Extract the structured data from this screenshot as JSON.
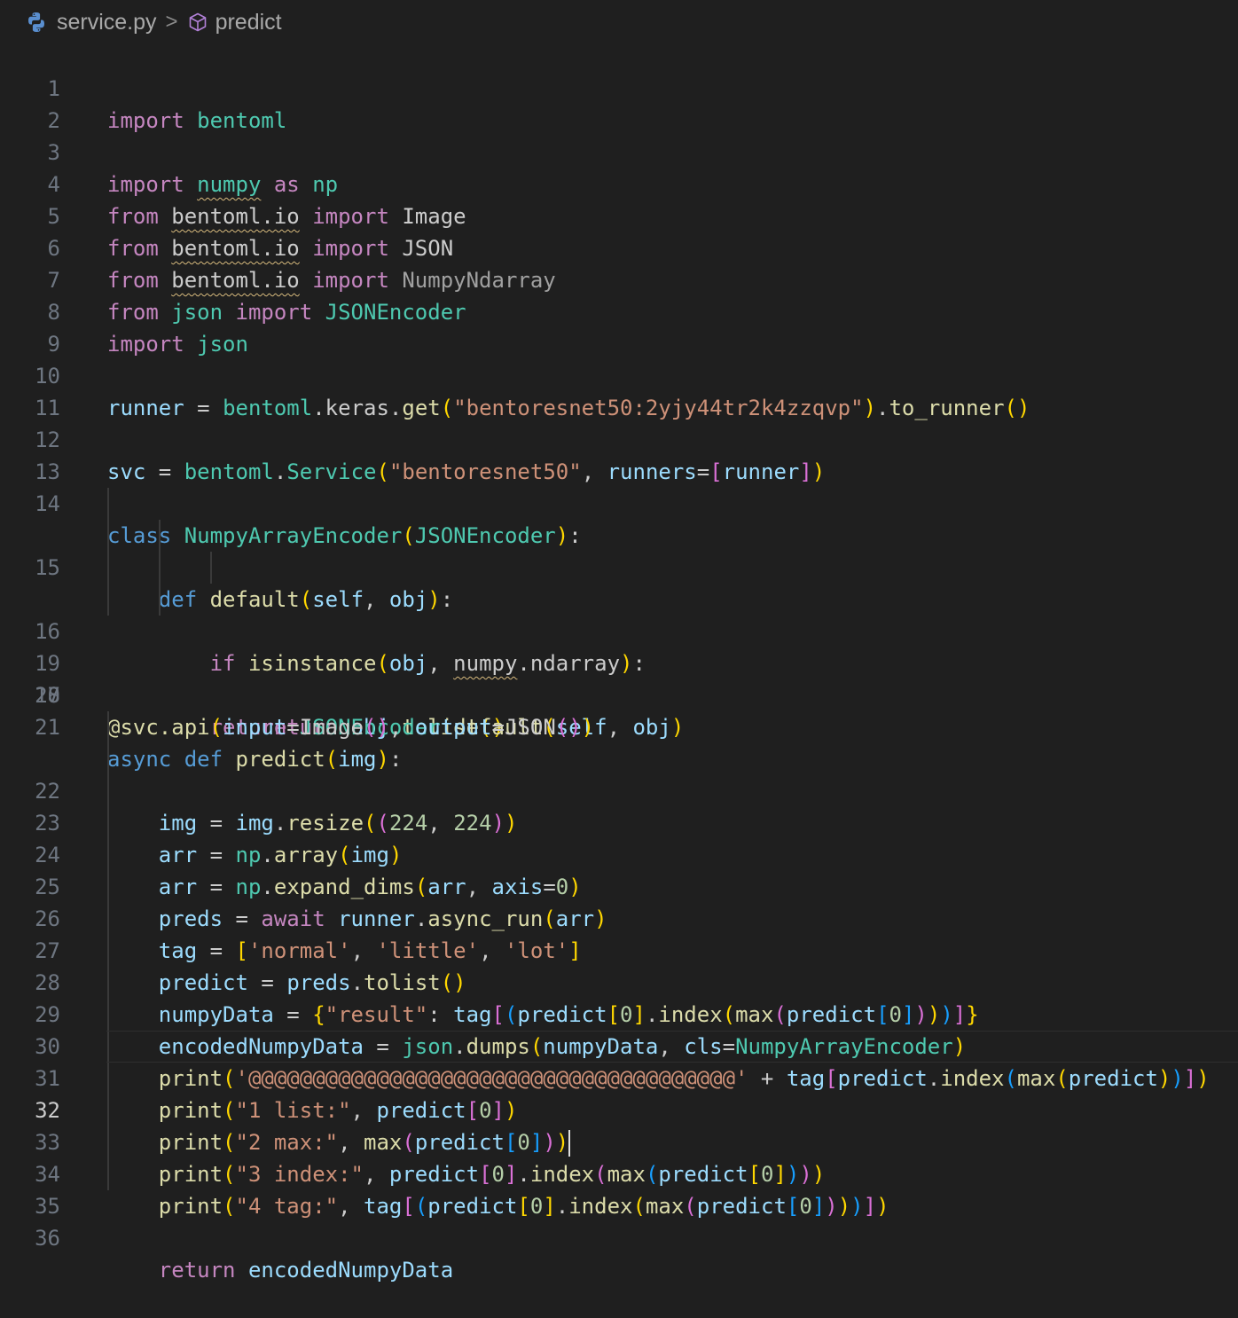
{
  "breadcrumb": {
    "file_name": "service.py",
    "separator": ">",
    "symbol_name": "predict"
  },
  "editor": {
    "language": "python",
    "active_line": 32,
    "line_numbers": [
      "1",
      "2",
      "3",
      "4",
      "5",
      "6",
      "7",
      "8",
      "9",
      "10",
      "11",
      "12",
      "13",
      "14",
      "15",
      "16",
      "17",
      "18",
      "19",
      "20",
      "21",
      "22",
      "23",
      "24",
      "25",
      "26",
      "27",
      "28",
      "29",
      "30",
      "31",
      "32",
      "33",
      "34",
      "35",
      "36"
    ],
    "lines": [
      "import bentoml",
      "",
      "import numpy as np",
      "from bentoml.io import Image",
      "from bentoml.io import JSON",
      "from bentoml.io import NumpyNdarray",
      "from json import JSONEncoder",
      "import json",
      "",
      "runner = bentoml.keras.get(\"bentoresnet50:2yjy44tr2k4zzqvp\").to_runner()",
      "",
      "svc = bentoml.Service(\"bentoresnet50\", runners=[runner])",
      "",
      "class NumpyArrayEncoder(JSONEncoder):",
      "    def default(self, obj):",
      "        if isinstance(obj, numpy.ndarray):",
      "            return obj.tolist()",
      "        return JSONEncoder.default(self, obj)",
      "",
      "@svc.api(input=Image(), output=JSON())",
      "async def predict(img):",
      "    img = img.resize((224, 224))",
      "    arr = np.array(img)",
      "    arr = np.expand_dims(arr, axis=0)",
      "    preds = await runner.async_run(arr)",
      "    tag = ['normal', 'little', 'lot']",
      "    predict = preds.tolist()",
      "    numpyData = {\"result\": tag[(predict[0].index(max(predict[0])))]}",
      "    encodedNumpyData = json.dumps(numpyData, cls=NumpyArrayEncoder)",
      "    print('@@@@@@@@@@@@@@@@@@@@@@@@@@@@@@@@@@@@@@' + tag[predict.index(max(predict))])",
      "    print(\"1 list:\", predict[0])",
      "    print(\"2 max:\", max(predict[0]))",
      "    print(\"3 index:\", predict[0].index(max(predict[0])))",
      "    print(\"4 tag:\", tag[(predict[0].index(max(predict[0])))])",
      "",
      "    return encodedNumpyData"
    ]
  },
  "colors": {
    "background": "#1f1f1f",
    "keyword": "#c586c0",
    "storage_keyword": "#569cd6",
    "module_class": "#4ec9b0",
    "function": "#dcdcaa",
    "variable": "#9cdcfe",
    "string": "#ce9178",
    "number": "#b5cea8",
    "bracket_level_1": "#ffd700",
    "bracket_level_2": "#da70d6",
    "bracket_level_3": "#179fff"
  },
  "icons": {
    "file_icon": "python-icon",
    "symbol_icon": "cube-icon"
  }
}
